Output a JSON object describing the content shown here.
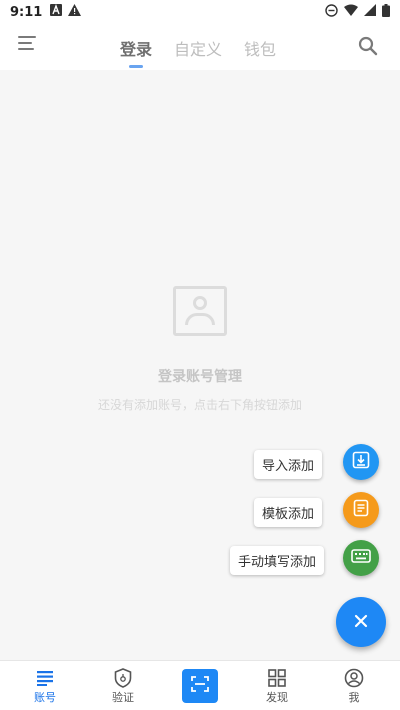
{
  "status_bar": {
    "time": "9:11"
  },
  "header": {
    "tabs": [
      {
        "label": "登录",
        "active": true
      },
      {
        "label": "自定义",
        "active": false
      },
      {
        "label": "钱包",
        "active": false
      }
    ]
  },
  "empty_state": {
    "title": "登录账号管理",
    "subtitle": "还没有添加账号，点击右下角按钮添加"
  },
  "fab_menu": {
    "items": [
      {
        "label": "导入添加",
        "color": "#2196f3",
        "icon": "import-icon"
      },
      {
        "label": "模板添加",
        "color": "#f59a1b",
        "icon": "template-icon"
      },
      {
        "label": "手动填写添加",
        "color": "#43a047",
        "icon": "keyboard-icon"
      }
    ],
    "main_color": "#1e88f5",
    "main_icon": "close-icon"
  },
  "bottom_nav": {
    "items": [
      {
        "label": "账号",
        "icon": "list-icon",
        "active": true
      },
      {
        "label": "验证",
        "icon": "shield-icon",
        "active": false
      },
      {
        "label": "",
        "icon": "scan-icon",
        "active": false
      },
      {
        "label": "发现",
        "icon": "grid-icon",
        "active": false
      },
      {
        "label": "我",
        "icon": "user-icon",
        "active": false
      }
    ]
  },
  "colors": {
    "accent": "#1a73e8",
    "background": "#f1f1f1"
  }
}
